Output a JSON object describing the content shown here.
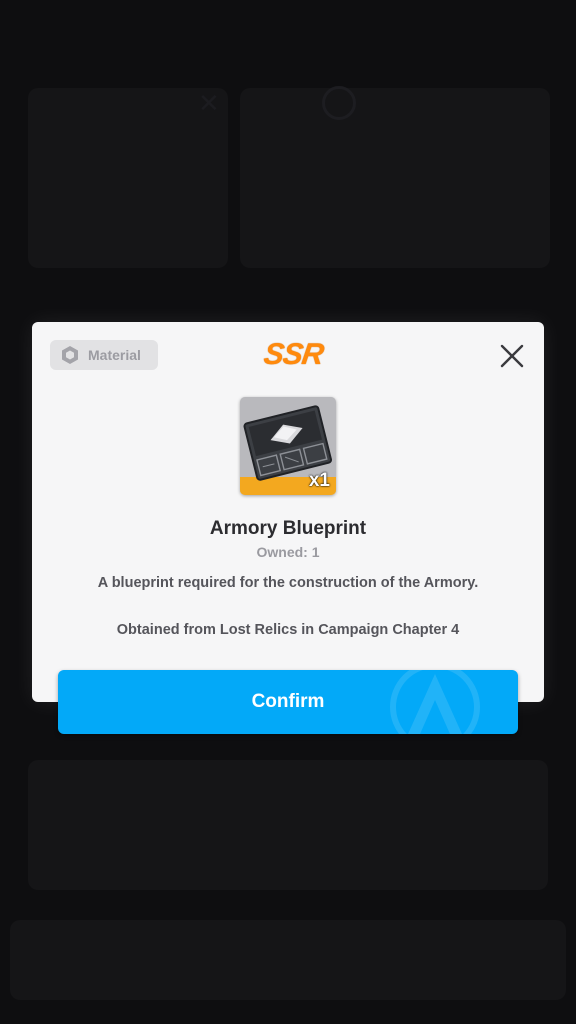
{
  "modal": {
    "category_label": "Material",
    "rarity": "SSR",
    "item_name": "Armory Blueprint",
    "item_count": "x1",
    "owned_text": "Owned: 1",
    "description": "A blueprint required for the construction of the Armory.",
    "source_text": "Obtained from Lost Relics in Campaign Chapter 4",
    "confirm_label": "Confirm"
  },
  "icons": {
    "category": "hexagon-icon",
    "close": "close-icon",
    "item": "blueprint-icon"
  },
  "colors": {
    "rarity": "#ff8a0d",
    "confirm_button": "#03a9f8",
    "modal_background": "#f6f6f7",
    "overlay": "#0b0b0c"
  }
}
